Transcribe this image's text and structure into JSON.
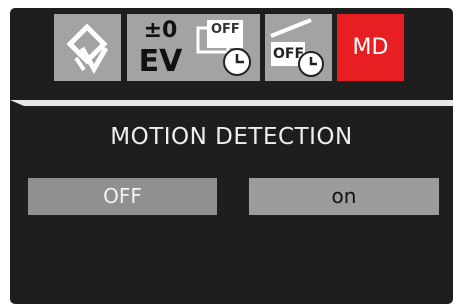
{
  "toolbar": {
    "tiles": [
      {
        "name": "image-rotation-icon"
      },
      {
        "name": "exposure-icon",
        "top": "±0",
        "bottom": "EV"
      },
      {
        "name": "screen-off-timer-icon"
      },
      {
        "name": "auto-power-off-timer-icon"
      },
      {
        "name": "motion-detection-tab",
        "label": "MD"
      }
    ],
    "screen_off_icon_text": "OFF",
    "power_off_icon_text": "OFF"
  },
  "menu": {
    "title": "MOTION DETECTION",
    "options": [
      "OFF",
      "on"
    ]
  },
  "colors": {
    "screen_bg": "#1e1e1e",
    "tile": "#a3a3a3",
    "active_tile": "#e81f22",
    "option_bg": "#909090"
  }
}
